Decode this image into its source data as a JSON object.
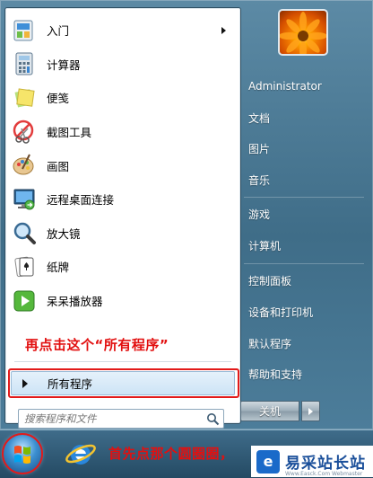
{
  "start_menu": {
    "programs": [
      {
        "label": "入门",
        "icon": "getting-started-icon",
        "has_submenu": true
      },
      {
        "label": "计算器",
        "icon": "calculator-icon",
        "has_submenu": false
      },
      {
        "label": "便笺",
        "icon": "sticky-notes-icon",
        "has_submenu": false
      },
      {
        "label": "截图工具",
        "icon": "snipping-tool-icon",
        "has_submenu": false
      },
      {
        "label": "画图",
        "icon": "paint-icon",
        "has_submenu": false
      },
      {
        "label": "远程桌面连接",
        "icon": "remote-desktop-icon",
        "has_submenu": false
      },
      {
        "label": "放大镜",
        "icon": "magnifier-icon",
        "has_submenu": false
      },
      {
        "label": "纸牌",
        "icon": "solitaire-icon",
        "has_submenu": false
      },
      {
        "label": "呆呆播放器",
        "icon": "media-player-icon",
        "has_submenu": false
      }
    ],
    "all_programs_label": "所有程序",
    "search": {
      "placeholder": "搜索程序和文件"
    },
    "right_items": [
      {
        "label": "Administrator"
      },
      {
        "label": "文档"
      },
      {
        "label": "图片"
      },
      {
        "label": "音乐"
      },
      {
        "label": "游戏"
      },
      {
        "label": "计算机"
      },
      {
        "label": "控制面板"
      },
      {
        "label": "设备和打印机"
      },
      {
        "label": "默认程序"
      },
      {
        "label": "帮助和支持"
      }
    ],
    "shutdown_label": "关机"
  },
  "annotations": {
    "click_all_programs": "再点击这个“所有程序”",
    "click_start_orb": "首先点那个圆圈圈，"
  },
  "watermark": {
    "name": "易采站长站",
    "url": "Www.Easck.Com  Webmaster"
  },
  "colors": {
    "annotation_red": "#e21010",
    "taskbar": "#244a63"
  }
}
